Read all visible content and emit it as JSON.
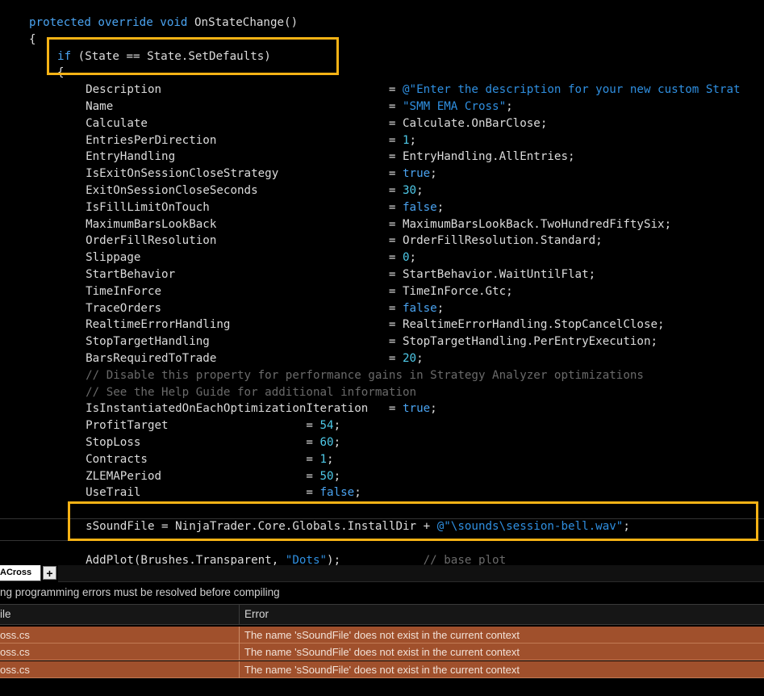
{
  "editor": {
    "lines": [
      {
        "indent": "    ",
        "tokens": [
          {
            "t": "protected override void",
            "c": "kw"
          },
          {
            "t": " OnStateChange()",
            "c": ""
          }
        ]
      },
      {
        "indent": "    ",
        "tokens": [
          {
            "t": "{",
            "c": ""
          }
        ]
      },
      {
        "indent": "        ",
        "tokens": [
          {
            "t": "if",
            "c": "kw"
          },
          {
            "t": " (State == State.SetDefaults)",
            "c": ""
          }
        ]
      },
      {
        "indent": "        ",
        "tokens": [
          {
            "t": "{",
            "c": ""
          }
        ]
      },
      {
        "indent": "            ",
        "tokens": [
          {
            "t": "Description                                 ",
            "c": ""
          },
          {
            "t": "= ",
            "c": ""
          },
          {
            "t": "@\"Enter the description for your new custom Strat",
            "c": "str"
          }
        ]
      },
      {
        "indent": "            ",
        "tokens": [
          {
            "t": "Name                                        ",
            "c": ""
          },
          {
            "t": "= ",
            "c": ""
          },
          {
            "t": "\"SMM EMA Cross\"",
            "c": "str"
          },
          {
            "t": ";",
            "c": ""
          }
        ]
      },
      {
        "indent": "            ",
        "tokens": [
          {
            "t": "Calculate                                   = Calculate.OnBarClose;",
            "c": ""
          }
        ]
      },
      {
        "indent": "            ",
        "tokens": [
          {
            "t": "EntriesPerDirection                         = ",
            "c": ""
          },
          {
            "t": "1",
            "c": "num"
          },
          {
            "t": ";",
            "c": ""
          }
        ]
      },
      {
        "indent": "            ",
        "tokens": [
          {
            "t": "EntryHandling                               = EntryHandling.AllEntries;",
            "c": ""
          }
        ]
      },
      {
        "indent": "            ",
        "tokens": [
          {
            "t": "IsExitOnSessionCloseStrategy                = ",
            "c": ""
          },
          {
            "t": "true",
            "c": "kw"
          },
          {
            "t": ";",
            "c": ""
          }
        ]
      },
      {
        "indent": "            ",
        "tokens": [
          {
            "t": "ExitOnSessionCloseSeconds                   = ",
            "c": ""
          },
          {
            "t": "30",
            "c": "num"
          },
          {
            "t": ";",
            "c": ""
          }
        ]
      },
      {
        "indent": "            ",
        "tokens": [
          {
            "t": "IsFillLimitOnTouch                          = ",
            "c": ""
          },
          {
            "t": "false",
            "c": "kw"
          },
          {
            "t": ";",
            "c": ""
          }
        ]
      },
      {
        "indent": "            ",
        "tokens": [
          {
            "t": "MaximumBarsLookBack                         = MaximumBarsLookBack.TwoHundredFiftySix;",
            "c": ""
          }
        ]
      },
      {
        "indent": "            ",
        "tokens": [
          {
            "t": "OrderFillResolution                         = OrderFillResolution.Standard;",
            "c": ""
          }
        ]
      },
      {
        "indent": "            ",
        "tokens": [
          {
            "t": "Slippage                                    = ",
            "c": ""
          },
          {
            "t": "0",
            "c": "num"
          },
          {
            "t": ";",
            "c": ""
          }
        ]
      },
      {
        "indent": "            ",
        "tokens": [
          {
            "t": "StartBehavior                               = StartBehavior.WaitUntilFlat;",
            "c": ""
          }
        ]
      },
      {
        "indent": "            ",
        "tokens": [
          {
            "t": "TimeInForce                                 = TimeInForce.Gtc;",
            "c": ""
          }
        ]
      },
      {
        "indent": "            ",
        "tokens": [
          {
            "t": "TraceOrders                                 = ",
            "c": ""
          },
          {
            "t": "false",
            "c": "kw"
          },
          {
            "t": ";",
            "c": ""
          }
        ]
      },
      {
        "indent": "            ",
        "tokens": [
          {
            "t": "RealtimeErrorHandling                       = RealtimeErrorHandling.StopCancelClose;",
            "c": ""
          }
        ]
      },
      {
        "indent": "            ",
        "tokens": [
          {
            "t": "StopTargetHandling                          = StopTargetHandling.PerEntryExecution;",
            "c": ""
          }
        ]
      },
      {
        "indent": "            ",
        "tokens": [
          {
            "t": "BarsRequiredToTrade                         = ",
            "c": ""
          },
          {
            "t": "20",
            "c": "num"
          },
          {
            "t": ";",
            "c": ""
          }
        ]
      },
      {
        "indent": "            ",
        "tokens": [
          {
            "t": "// Disable this property for performance gains in Strategy Analyzer optimizations",
            "c": "com"
          }
        ]
      },
      {
        "indent": "            ",
        "tokens": [
          {
            "t": "// See the Help Guide for additional information",
            "c": "com"
          }
        ]
      },
      {
        "indent": "            ",
        "tokens": [
          {
            "t": "IsInstantiatedOnEachOptimizationIteration   = ",
            "c": ""
          },
          {
            "t": "true",
            "c": "kw"
          },
          {
            "t": ";",
            "c": ""
          }
        ]
      },
      {
        "indent": "            ",
        "tokens": [
          {
            "t": "ProfitTarget                    = ",
            "c": ""
          },
          {
            "t": "54",
            "c": "num"
          },
          {
            "t": ";",
            "c": ""
          }
        ]
      },
      {
        "indent": "            ",
        "tokens": [
          {
            "t": "StopLoss                        = ",
            "c": ""
          },
          {
            "t": "60",
            "c": "num"
          },
          {
            "t": ";",
            "c": ""
          }
        ]
      },
      {
        "indent": "            ",
        "tokens": [
          {
            "t": "Contracts                       = ",
            "c": ""
          },
          {
            "t": "1",
            "c": "num"
          },
          {
            "t": ";",
            "c": ""
          }
        ]
      },
      {
        "indent": "            ",
        "tokens": [
          {
            "t": "ZLEMAPeriod                     = ",
            "c": ""
          },
          {
            "t": "50",
            "c": "num"
          },
          {
            "t": ";",
            "c": ""
          }
        ]
      },
      {
        "indent": "            ",
        "tokens": [
          {
            "t": "UseTrail                        = ",
            "c": ""
          },
          {
            "t": "false",
            "c": "kw"
          },
          {
            "t": ";",
            "c": ""
          }
        ]
      },
      {
        "indent": "",
        "tokens": []
      },
      {
        "indent": "            ",
        "tokens": [
          {
            "t": "sSoundFile = NinjaTrader.Core.Globals.InstallDir + ",
            "c": ""
          },
          {
            "t": "@\"\\sounds\\session-bell.wav\"",
            "c": "str"
          },
          {
            "t": ";",
            "c": ""
          }
        ]
      },
      {
        "indent": "",
        "tokens": []
      },
      {
        "indent": "            ",
        "tokens": [
          {
            "t": "AddPlot(Brushes.Transparent, ",
            "c": ""
          },
          {
            "t": "\"Dots\"",
            "c": "str"
          },
          {
            "t": ");            ",
            "c": ""
          },
          {
            "t": "// base plot",
            "c": "com"
          }
        ]
      }
    ]
  },
  "panel": {
    "tab_label": "ACross",
    "tab_add_label": "+",
    "message": "ng programming errors must be resolved before compiling",
    "columns": {
      "file": "ile",
      "error": "Error"
    },
    "rows": [
      {
        "file": "oss.cs",
        "error": "The name 'sSoundFile' does not exist in the current context"
      },
      {
        "file": "oss.cs",
        "error": "The name 'sSoundFile' does not exist in the current context"
      },
      {
        "file": "oss.cs",
        "error": "The name 'sSoundFile' does not exist in the current context"
      }
    ]
  },
  "colors": {
    "highlight_box": "#f5b215",
    "error_row": "#a0502c",
    "keyword": "#4aa3f0"
  }
}
